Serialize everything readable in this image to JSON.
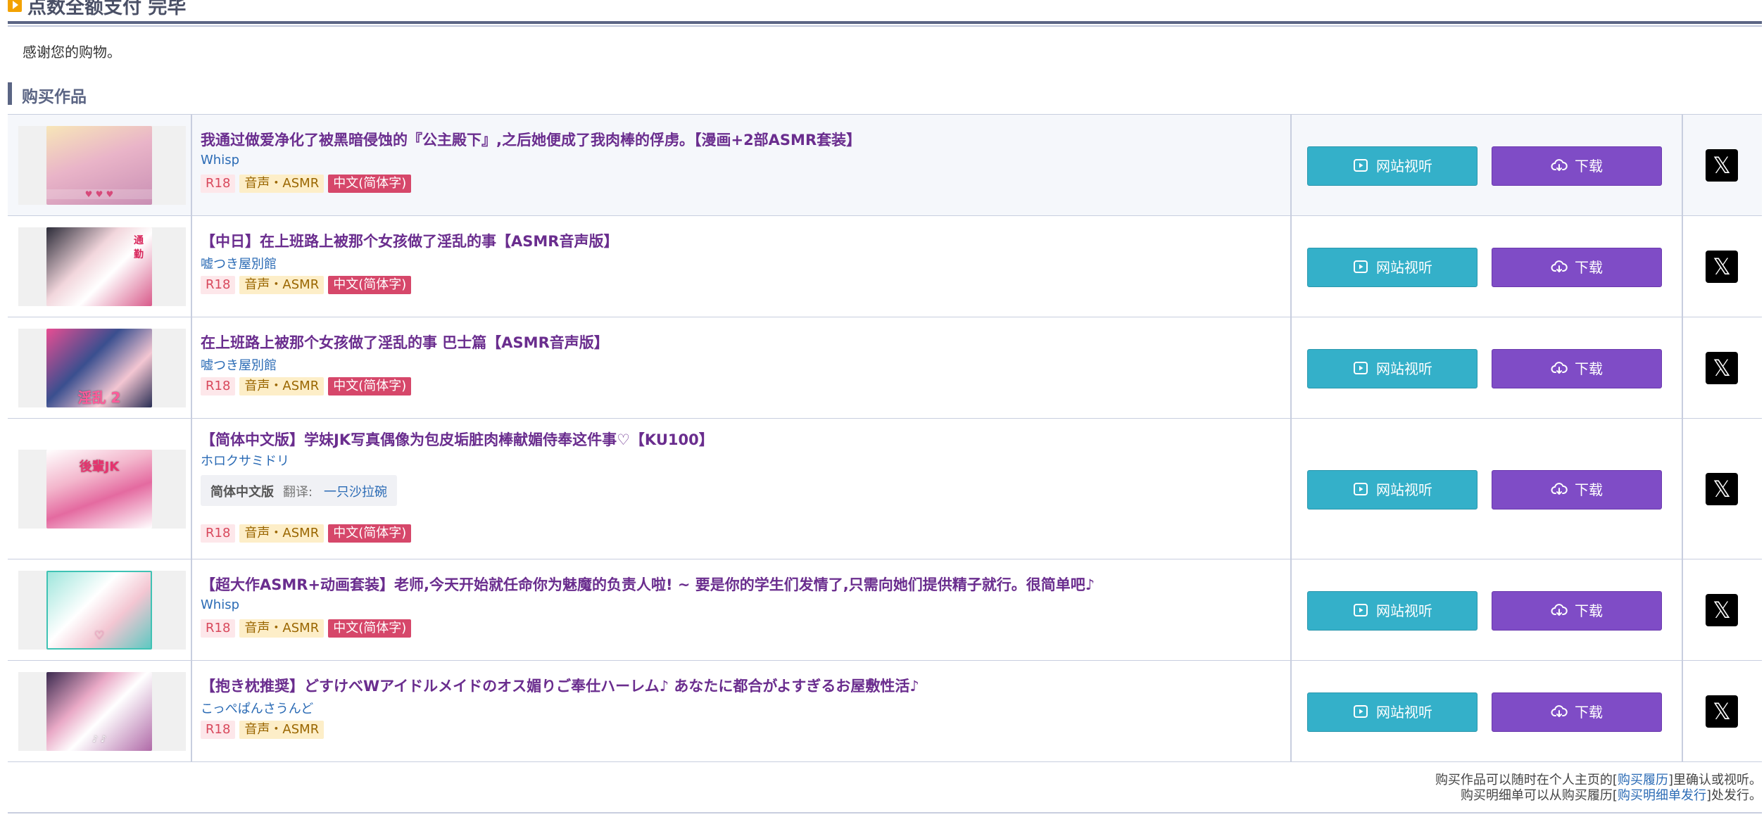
{
  "header": {
    "title": "点数全额支付 完毕",
    "icon": "play-icon"
  },
  "thanks": "感谢您的购物。",
  "section": {
    "title": "购买作品"
  },
  "buttons": {
    "view": "网站视听",
    "download": "下载",
    "share_icon": "x-logo-icon"
  },
  "tags": {
    "r18": "R18",
    "genre": "音声・ASMR",
    "lang": "中文(简体字)"
  },
  "works": [
    {
      "title": "我通过做爱净化了被黑暗侵蚀的『公主殿下』,之后她便成了我肉棒的俘虏。【漫画+2部ASMR套装】",
      "circle": "Whisp",
      "tags": [
        "R18",
        "音声・ASMR",
        "中文(简体字)"
      ],
      "thumb_color": "#e9b4c8"
    },
    {
      "title": "【中日】在上班路上被那个女孩做了淫乱的事【ASMR音声版】",
      "circle": "嘘つき屋別館",
      "tags": [
        "R18",
        "音声・ASMR",
        "中文(简体字)"
      ],
      "thumb_color": "#d85a8a"
    },
    {
      "title": "在上班路上被那个女孩做了淫乱的事 巴士篇【ASMR音声版】",
      "circle": "嘘つき屋別館",
      "tags": [
        "R18",
        "音声・ASMR",
        "中文(简体字)"
      ],
      "thumb_color": "#3a4f8f"
    },
    {
      "title": "【简体中文版】学妹JK写真偶像为包皮垢脏肉棒献媚侍奉这件事♡【KU100】",
      "circle": "ホロクサミドリ",
      "translation": {
        "label": "简体中文版",
        "by": "翻译:",
        "name": "一只沙拉碗"
      },
      "tags": [
        "R18",
        "音声・ASMR",
        "中文(简体字)"
      ],
      "thumb_color": "#e46aa0"
    },
    {
      "title": "【超大作ASMR+动画套装】老师,今天开始就任命你为魅魔的负责人啦! ~ 要是你的学生们发情了,只需向她们提供精子就行。很简单吧♪",
      "circle": "Whisp",
      "tags": [
        "R18",
        "音声・ASMR",
        "中文(简体字)"
      ],
      "thumb_color": "#5fc9c2"
    },
    {
      "title": "【抱き枕推奨】どすけべWアイドルメイドのオス媚りご奉仕ハーレム♪ あなたに都合がよすぎるお屋敷性活♪",
      "circle": "こっぺぱんさうんど",
      "tags": [
        "R18",
        "音声・ASMR"
      ],
      "thumb_color": "#b06aa8"
    }
  ],
  "footer": {
    "line1_pre": "购买作品可以随时在个人主页的[",
    "line1_link": "购买履历",
    "line1_post": "]里确认或视听。",
    "line2_pre": "购买明细单可以从购买履历[",
    "line2_link": "购买明细单发行",
    "line2_post": "]处发行。"
  }
}
